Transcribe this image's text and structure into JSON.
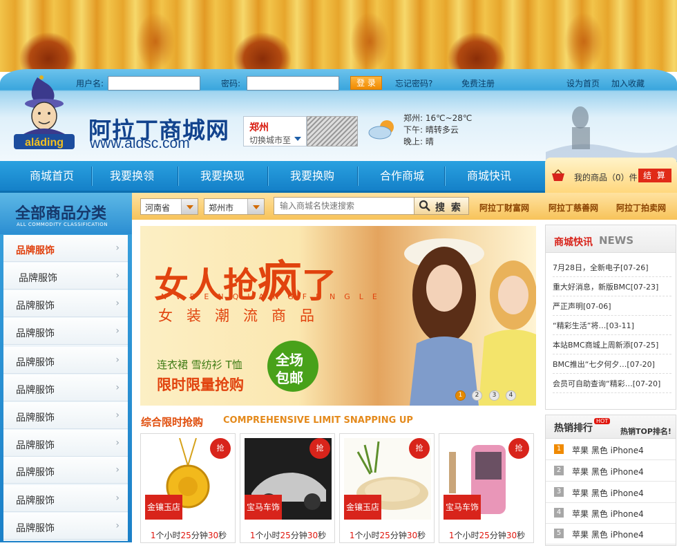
{
  "login": {
    "username_label": "用户名:",
    "password_label": "密码:",
    "login_button": "登 录",
    "forgot_link": "忘记密码?",
    "register_link": "免费注册",
    "set_home": "设为首页",
    "add_favorite": "加入收藏"
  },
  "logo": {
    "brand": "aláding",
    "name_cn": "阿拉丁商城网",
    "url": "www.aldsc.com"
  },
  "city": {
    "name": "郑州",
    "switch_label": "切换城市至"
  },
  "weather": {
    "line1": "郑州: 16℃~28℃",
    "line2": "下午: 晴转多云",
    "line3": "晚上: 晴"
  },
  "nav": {
    "items": [
      "商城首页",
      "我要换领",
      "我要换现",
      "我要换购",
      "合作商城",
      "商城快讯"
    ],
    "cart_text": "我的商品（0）件",
    "checkout": "结 算"
  },
  "sidebar": {
    "title": "全部商品分类",
    "subtitle": "ALL COMMODITY CLASSIFICATION",
    "items": [
      "品牌服饰",
      "品牌服饰",
      "品牌服饰",
      "品牌服饰",
      "品牌服饰",
      "品牌服饰",
      "品牌服饰",
      "品牌服饰",
      "品牌服饰",
      "品牌服饰",
      "品牌服饰"
    ]
  },
  "search": {
    "province": "河南省",
    "city": "郑州市",
    "placeholder": "输入商城名快速搜索",
    "button": "搜 索",
    "links": [
      "阿拉丁财富网",
      "阿拉丁慈善网",
      "阿拉丁拍卖网"
    ]
  },
  "banner": {
    "headline_a": "女人抢",
    "headline_b": "疯",
    "headline_c": "了",
    "pinyin": "NVRENQIANGFENGLE",
    "subline": "女装潮流商品",
    "items": "连衣裙 雪纺衫 T恤",
    "deal": "限时限量抢购",
    "badge_l1": "全场",
    "badge_l2": "包邮",
    "pages": [
      "1",
      "2",
      "3",
      "4"
    ]
  },
  "section": {
    "title_cn": "综合限时抢购",
    "title_en": "COMPREHENSIVE LIMIT SNAPPING UP"
  },
  "products": [
    {
      "tag": "金镶玉店",
      "badge": "抢",
      "h": "1",
      "m": "25",
      "s": "30"
    },
    {
      "tag": "宝马车饰",
      "badge": "抢",
      "h": "1",
      "m": "25",
      "s": "30"
    },
    {
      "tag": "金镶玉店",
      "badge": "抢",
      "h": "1",
      "m": "25",
      "s": "30"
    },
    {
      "tag": "宝马车饰",
      "badge": "抢",
      "h": "1",
      "m": "25",
      "s": "30"
    }
  ],
  "time_units": {
    "h": "个小时",
    "m": "分钟",
    "s": "秒"
  },
  "news": {
    "title_cn": "商城快讯",
    "title_en": "NEWS",
    "items": [
      "7月28日，全新电子[07-26]",
      "重大好消息，新版BMC[07-23]",
      "严正声明[07-06]",
      "“精彩生活”将…[03-11]",
      "本站BMC商城上周新添[07-25]",
      "BMC推出“七夕何夕…[07-20]",
      "会员可自助查询“精彩…[07-20]"
    ]
  },
  "hot": {
    "title": "热销排行",
    "badge": "HOT",
    "right": "热销TOP排名!",
    "items": [
      {
        "n": "1",
        "t": "苹果 黑色 iPhone4"
      },
      {
        "n": "2",
        "t": "苹果 黑色 iPhone4"
      },
      {
        "n": "3",
        "t": "苹果 黑色 iPhone4"
      },
      {
        "n": "4",
        "t": "苹果 黑色 iPhone4"
      },
      {
        "n": "5",
        "t": "苹果 黑色 iPhone4"
      }
    ]
  },
  "colors": {
    "nav_blue": "#1e8fd6",
    "accent_red": "#d8241b",
    "accent_orange": "#e1430e"
  }
}
